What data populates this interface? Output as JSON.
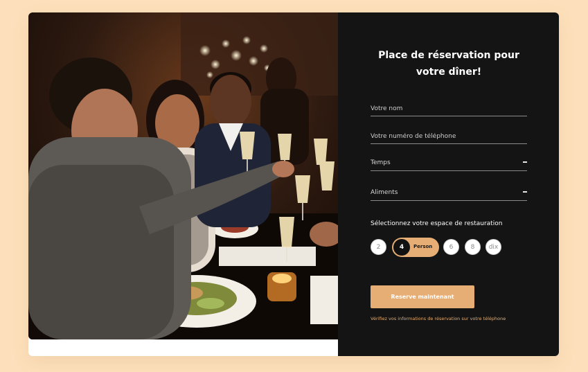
{
  "form": {
    "title": "Place de réservation pour votre dîner!",
    "name_placeholder": "Votre nom",
    "phone_placeholder": "Votre numéro de téléphone",
    "time_label": "Temps",
    "food_label": "Aliments",
    "section_label": "Sélectionnez votre espace de restauration",
    "seats": {
      "options": [
        "2",
        "4",
        "6",
        "8",
        "dix"
      ],
      "selected": "4",
      "selected_unit": "Person"
    },
    "submit_label": "Reserve maintenant",
    "note": "Vérifiez vos informations de réservation sur votre téléphone"
  },
  "colors": {
    "page_background": "#fde0bb",
    "panel_background": "#141414",
    "accent": "#e6ae74"
  }
}
